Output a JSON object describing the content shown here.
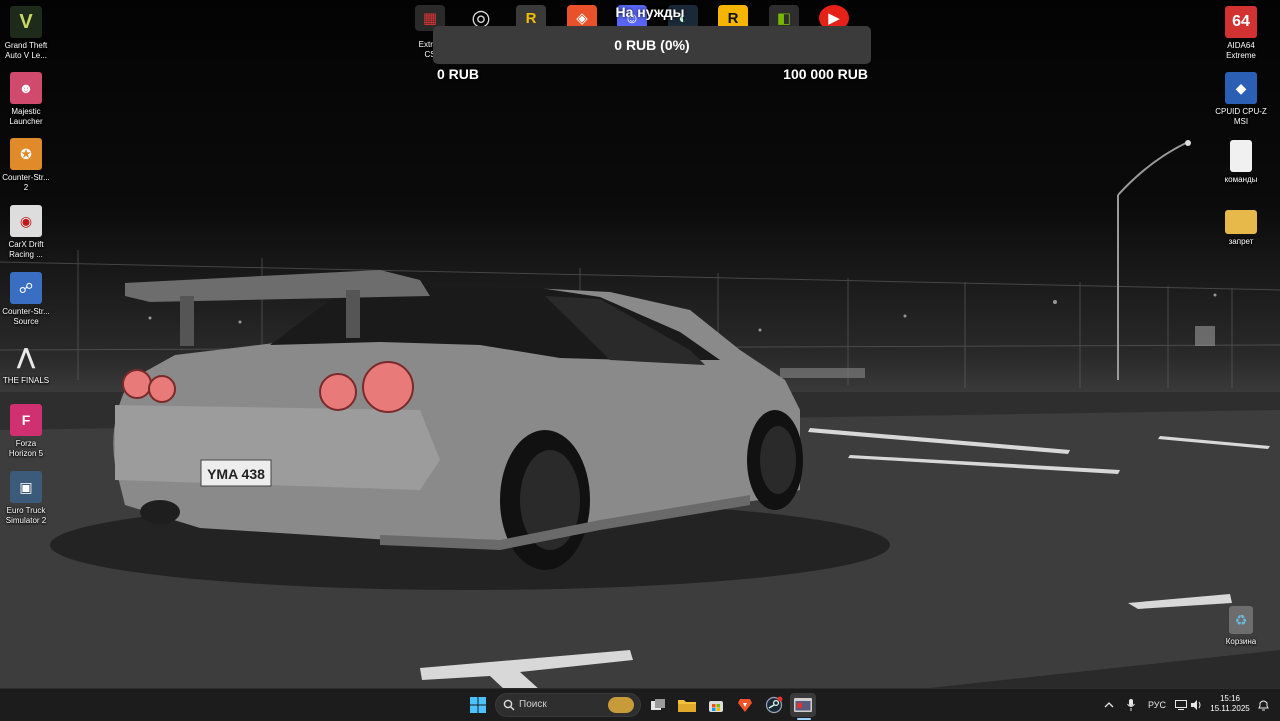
{
  "desktop_left": [
    {
      "label": "Grand Theft\nAuto V Le...",
      "glyph": "V",
      "bg": "#1e2a1a",
      "fg": "#c8d66a"
    },
    {
      "label": "Majestic\nLauncher",
      "glyph": "☻",
      "bg": "#d04a6e",
      "fg": "#fff"
    },
    {
      "label": "Counter-Str...\n2",
      "glyph": "✪",
      "bg": "#e08a2a",
      "fg": "#fff"
    },
    {
      "label": "CarX Drift\nRacing ...",
      "glyph": "◉",
      "bg": "#dddddd",
      "fg": "#c01818"
    },
    {
      "label": "Counter-Str...\nSource",
      "glyph": "☍",
      "bg": "#3a6ec2",
      "fg": "#fff"
    },
    {
      "label": "THE FINALS",
      "glyph": "⋀",
      "bg": "transparent",
      "fg": "#e9e9e9"
    },
    {
      "label": "Forza\nHorizon 5",
      "glyph": "F",
      "bg": "#d0306f",
      "fg": "#fff"
    },
    {
      "label": "Euro Truck\nSimulator 2",
      "glyph": "▣",
      "bg": "#3c5a7a",
      "fg": "#fff"
    }
  ],
  "desktop_right": [
    {
      "label": "AIDA64\nExtreme",
      "glyph": "64",
      "bg": "#d23232",
      "fg": "#fff"
    },
    {
      "label": "CPUID CPU-Z\nMSI",
      "glyph": "◆",
      "bg": "#2b5fb3",
      "fg": "#fff"
    },
    {
      "label": "команды",
      "glyph": "",
      "bg": "#f0f0f0",
      "fg": "#888"
    },
    {
      "label": "запрет",
      "glyph": "",
      "bg": "#e7b94a",
      "fg": "#fff"
    },
    {
      "label": "Корзина",
      "glyph": "♻",
      "bg": "#6bb7d9",
      "fg": "#fff"
    }
  ],
  "top_icons": [
    {
      "name": "extreme-cs-icon",
      "label": "Extrim\nCS",
      "glyph": "▦",
      "bg": "#2a2a2a",
      "fg": "#d33"
    },
    {
      "name": "obs-icon",
      "glyph": "◎",
      "bg": "transparent",
      "fg": "#ddd"
    },
    {
      "name": "rockstar-r-icon",
      "glyph": "R",
      "bg": "#3a3a3a",
      "fg": "#f0c000"
    },
    {
      "name": "brave-icon",
      "glyph": "◈",
      "bg": "#e8512a",
      "fg": "#fff"
    },
    {
      "name": "discord-icon",
      "glyph": "☺",
      "bg": "#5865f2",
      "fg": "#fff"
    },
    {
      "name": "steam-icon",
      "glyph": "◐",
      "bg": "#1b2838",
      "fg": "#cfd"
    },
    {
      "name": "rockstar-launcher-icon",
      "glyph": "R",
      "bg": "#f4b400",
      "fg": "#111"
    },
    {
      "name": "nvidia-icon",
      "glyph": "◧",
      "bg": "#2e2e2e",
      "fg": "#76b900"
    },
    {
      "name": "youtube-icon",
      "glyph": "▶",
      "bg": "#e62117",
      "fg": "#fff"
    }
  ],
  "donation": {
    "title": "На нужды",
    "progress_text": "0 RUB (0%)",
    "min": "0 RUB",
    "max": "100 000 RUB",
    "percent": 0,
    "fill_color": "#7ec241"
  },
  "car_plate": "YMA 438",
  "taskbar": {
    "search_placeholder": "Поиск",
    "pinned": [
      {
        "name": "windows-start-icon",
        "active": false
      },
      {
        "name": "task-view-icon",
        "active": false
      },
      {
        "name": "file-explorer-icon",
        "active": false
      },
      {
        "name": "microsoft-store-icon",
        "active": false
      },
      {
        "name": "brave-icon",
        "active": false
      },
      {
        "name": "steam-icon",
        "active": false
      },
      {
        "name": "app-window-icon",
        "active": true
      }
    ],
    "tray_lang": "РУС",
    "time": "15:16",
    "date": "15.11.2025"
  }
}
